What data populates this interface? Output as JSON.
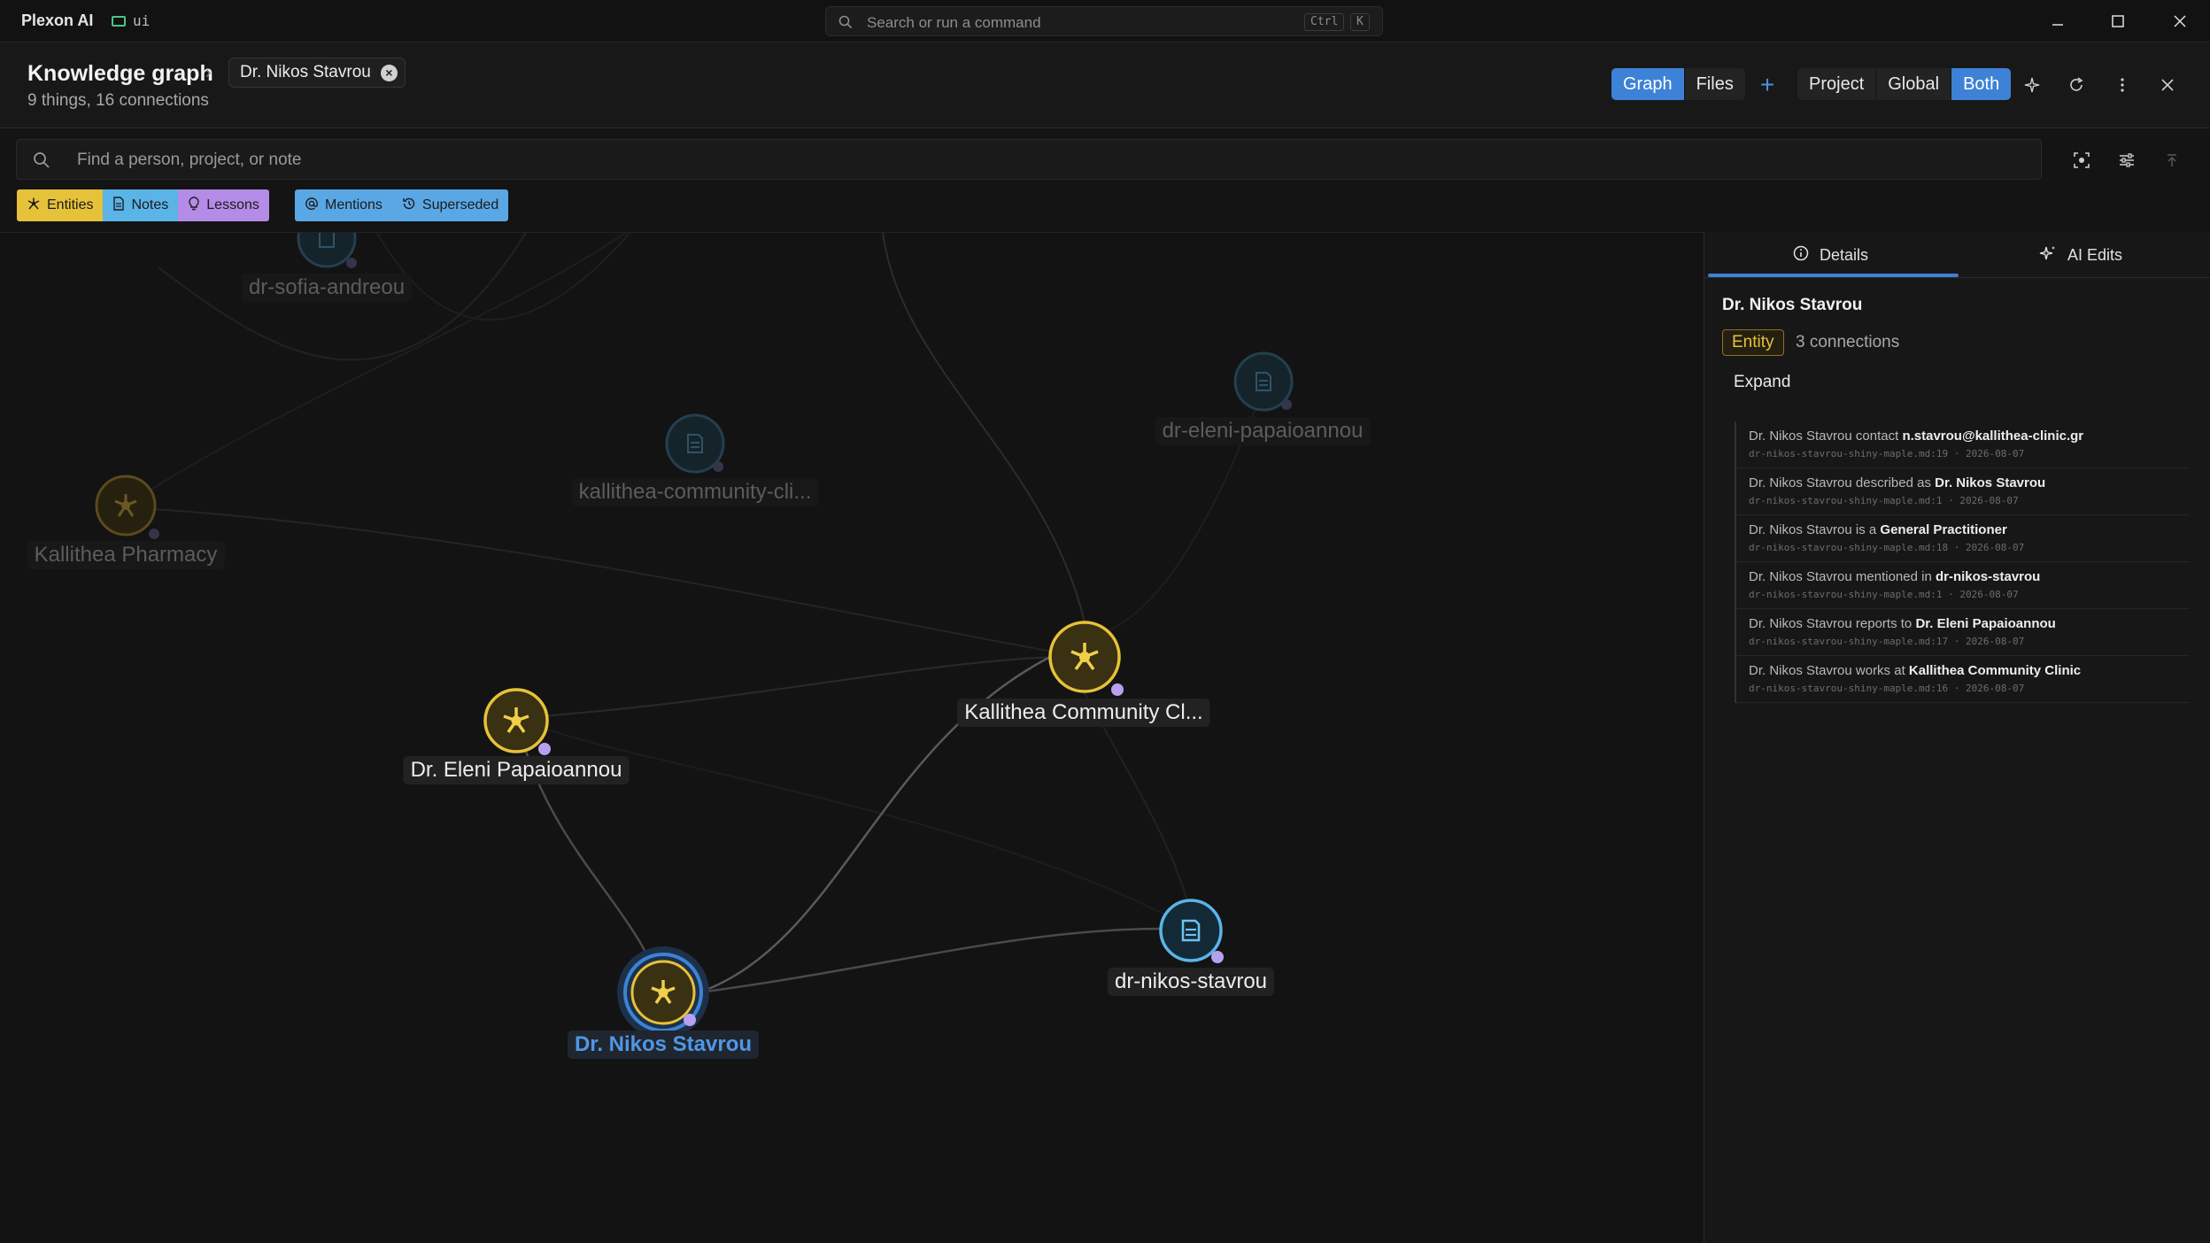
{
  "app": {
    "title": "Plexon AI",
    "workspace": "ui",
    "command_placeholder": "Search or run a command",
    "shortcut_mod": "Ctrl",
    "shortcut_key": "K"
  },
  "header": {
    "title": "Knowledge graph",
    "breadcrumb_chip": "Dr. Nikos Stavrou",
    "summary": "9 things, 16 connections",
    "view_tabs": [
      "Graph",
      "Files"
    ],
    "active_view": "Graph",
    "scope_tabs": [
      "Project",
      "Global",
      "Both"
    ],
    "active_scope": "Both"
  },
  "search": {
    "placeholder": "Find a person, project, or note"
  },
  "filters": {
    "entities": "Entities",
    "notes": "Notes",
    "lessons": "Lessons",
    "mentions": "Mentions",
    "superseded": "Superseded"
  },
  "graph": {
    "nodes": [
      {
        "label": "dr-sofia-andreou",
        "kind": "note",
        "state": "dim"
      },
      {
        "label": "dr-eleni-papaioannou",
        "kind": "note",
        "state": "dim"
      },
      {
        "label": "kallithea-community-cli...",
        "kind": "note",
        "state": "dim"
      },
      {
        "label": "Kallithea Pharmacy",
        "kind": "entity",
        "state": "dim"
      },
      {
        "label": "Kallithea Community Cl...",
        "kind": "entity",
        "state": "bright"
      },
      {
        "label": "Dr. Eleni Papaioannou",
        "kind": "entity",
        "state": "bright"
      },
      {
        "label": "Dr. Nikos Stavrou",
        "kind": "entity",
        "state": "selected"
      },
      {
        "label": "dr-nikos-stavrou",
        "kind": "note",
        "state": "bright"
      }
    ]
  },
  "panel": {
    "tabs": [
      "Details",
      "AI Edits"
    ],
    "active_tab": "Details",
    "title": "Dr. Nikos Stavrou",
    "badge": "Entity",
    "connections": "3 connections",
    "expand": "Expand",
    "facts": [
      {
        "subject": "Dr. Nikos Stavrou",
        "predicate": "contact",
        "object": "n.stavrou@kallithea-clinic.gr",
        "source": "dr-nikos-stavrou-shiny-maple.md:19 · 2026-08-07"
      },
      {
        "subject": "Dr. Nikos Stavrou",
        "predicate": "described as",
        "object": "Dr. Nikos Stavrou",
        "source": "dr-nikos-stavrou-shiny-maple.md:1 · 2026-08-07"
      },
      {
        "subject": "Dr. Nikos Stavrou",
        "predicate": "is a",
        "object": "General Practitioner",
        "source": "dr-nikos-stavrou-shiny-maple.md:18 · 2026-08-07"
      },
      {
        "subject": "Dr. Nikos Stavrou",
        "predicate": "mentioned in",
        "object": "dr-nikos-stavrou",
        "source": "dr-nikos-stavrou-shiny-maple.md:1 · 2026-08-07"
      },
      {
        "subject": "Dr. Nikos Stavrou",
        "predicate": "reports to",
        "object": "Dr. Eleni Papaioannou",
        "source": "dr-nikos-stavrou-shiny-maple.md:17 · 2026-08-07"
      },
      {
        "subject": "Dr. Nikos Stavrou",
        "predicate": "works at",
        "object": "Kallithea Community Clinic",
        "source": "dr-nikos-stavrou-shiny-maple.md:16 · 2026-08-07"
      }
    ]
  },
  "colors": {
    "accent": "#3d82d6",
    "entity": "#e6c13a",
    "note": "#5ab4e8",
    "lesson": "#b48be6"
  }
}
